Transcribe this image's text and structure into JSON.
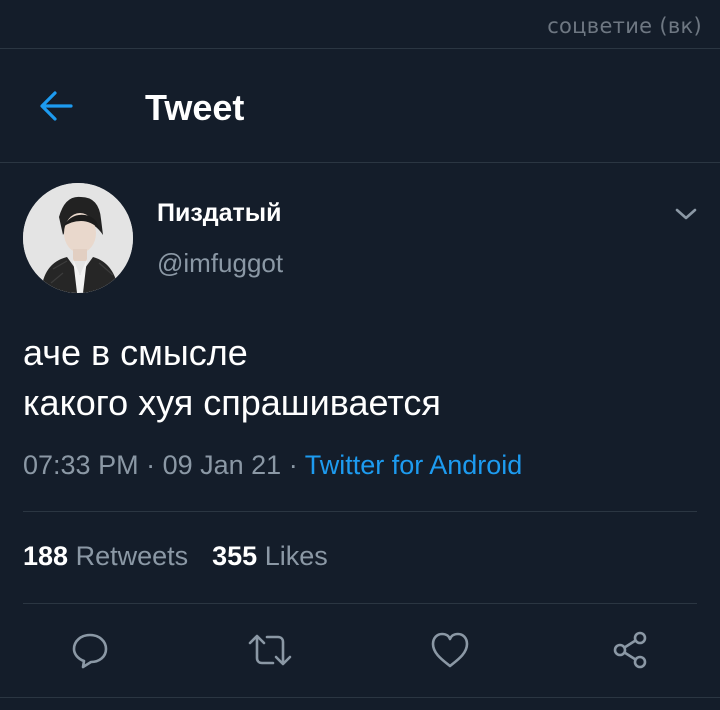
{
  "watermark": "соцветие (вк)",
  "header": {
    "title": "Tweet"
  },
  "author": {
    "display_name": "Пиздатый",
    "handle": "@imfuggot"
  },
  "tweet": {
    "lines": [
      "аче в смысле",
      "какого хуя спрашивается"
    ],
    "time": "07:33 PM",
    "separator": " · ",
    "date": "09 Jan 21",
    "source": "Twitter for Android"
  },
  "stats": {
    "retweets_count": "188",
    "retweets_label": "Retweets",
    "likes_count": "355",
    "likes_label": "Likes"
  },
  "colors": {
    "background": "#141d2a",
    "accent": "#1d9bf0",
    "muted": "#8b98a5"
  },
  "icons": [
    "back-arrow-icon",
    "chevron-down-icon",
    "reply-icon",
    "retweet-icon",
    "like-icon",
    "share-icon"
  ]
}
